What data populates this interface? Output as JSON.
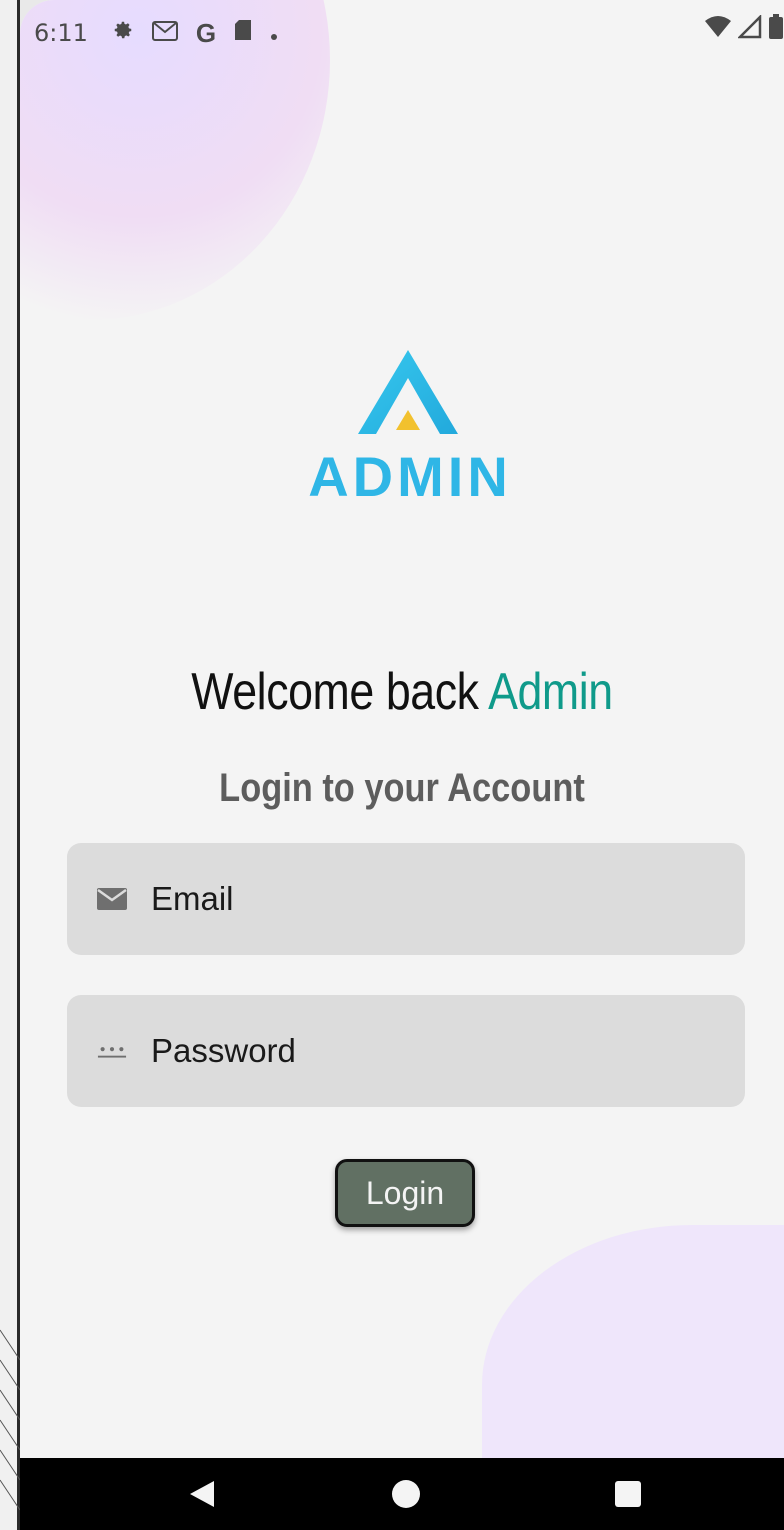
{
  "status_bar": {
    "time": "6:11",
    "icons": [
      "gear-icon",
      "gmail-icon",
      "google-icon",
      "sd-card-icon",
      "dot-icon",
      "wifi-icon",
      "signal-icon",
      "battery-icon"
    ]
  },
  "logo": {
    "text": "ADMIN"
  },
  "welcome": {
    "prefix": "Welcome back",
    "accent": "Admin"
  },
  "subtitle": "Login to your Account",
  "form": {
    "email_placeholder": "Email",
    "password_placeholder": "Password",
    "login_label": "Login"
  },
  "colors": {
    "accent": "#0f9a8a",
    "logo_blue": "#2fb6e6",
    "logo_yellow": "#f2c12e",
    "button_bg": "#617063",
    "field_bg": "#dcdcdc"
  },
  "nav": {
    "buttons": [
      "back-icon",
      "home-icon",
      "recents-icon"
    ]
  }
}
